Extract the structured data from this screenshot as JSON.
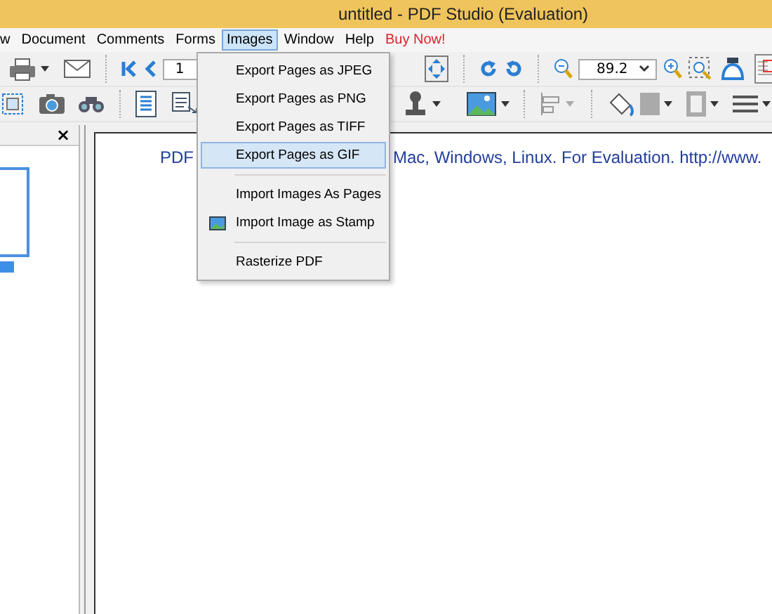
{
  "window": {
    "title": "untitled - PDF Studio (Evaluation)"
  },
  "menubar": [
    {
      "label": "w",
      "selected": false,
      "kind": "normal"
    },
    {
      "label": "Document",
      "selected": false,
      "kind": "normal"
    },
    {
      "label": "Comments",
      "selected": false,
      "kind": "normal"
    },
    {
      "label": "Forms",
      "selected": false,
      "kind": "normal"
    },
    {
      "label": "Images",
      "selected": true,
      "kind": "normal"
    },
    {
      "label": "Window",
      "selected": false,
      "kind": "normal"
    },
    {
      "label": "Help",
      "selected": false,
      "kind": "normal"
    },
    {
      "label": "Buy Now!",
      "selected": false,
      "kind": "promo"
    }
  ],
  "toolbar": {
    "page_field": "1",
    "zoom_field": "89.2"
  },
  "side_panel": {
    "close": "×"
  },
  "page_text": {
    "left": "PDF",
    "right": "Mac, Windows, Linux. For Evaluation. http://www."
  },
  "images_menu": [
    {
      "label": "Export Pages as JPEG",
      "selected": false,
      "kind": "item"
    },
    {
      "label": "Export Pages as PNG",
      "selected": false,
      "kind": "item"
    },
    {
      "label": "Export Pages as TIFF",
      "selected": false,
      "kind": "item"
    },
    {
      "label": "Export Pages as GIF",
      "selected": true,
      "kind": "item"
    },
    {
      "kind": "separator"
    },
    {
      "label": "Import Images As Pages",
      "selected": false,
      "kind": "item"
    },
    {
      "label": "Import Image as Stamp",
      "selected": false,
      "kind": "icon-item"
    },
    {
      "kind": "separator"
    },
    {
      "label": "Rasterize PDF",
      "selected": false,
      "kind": "item"
    }
  ]
}
